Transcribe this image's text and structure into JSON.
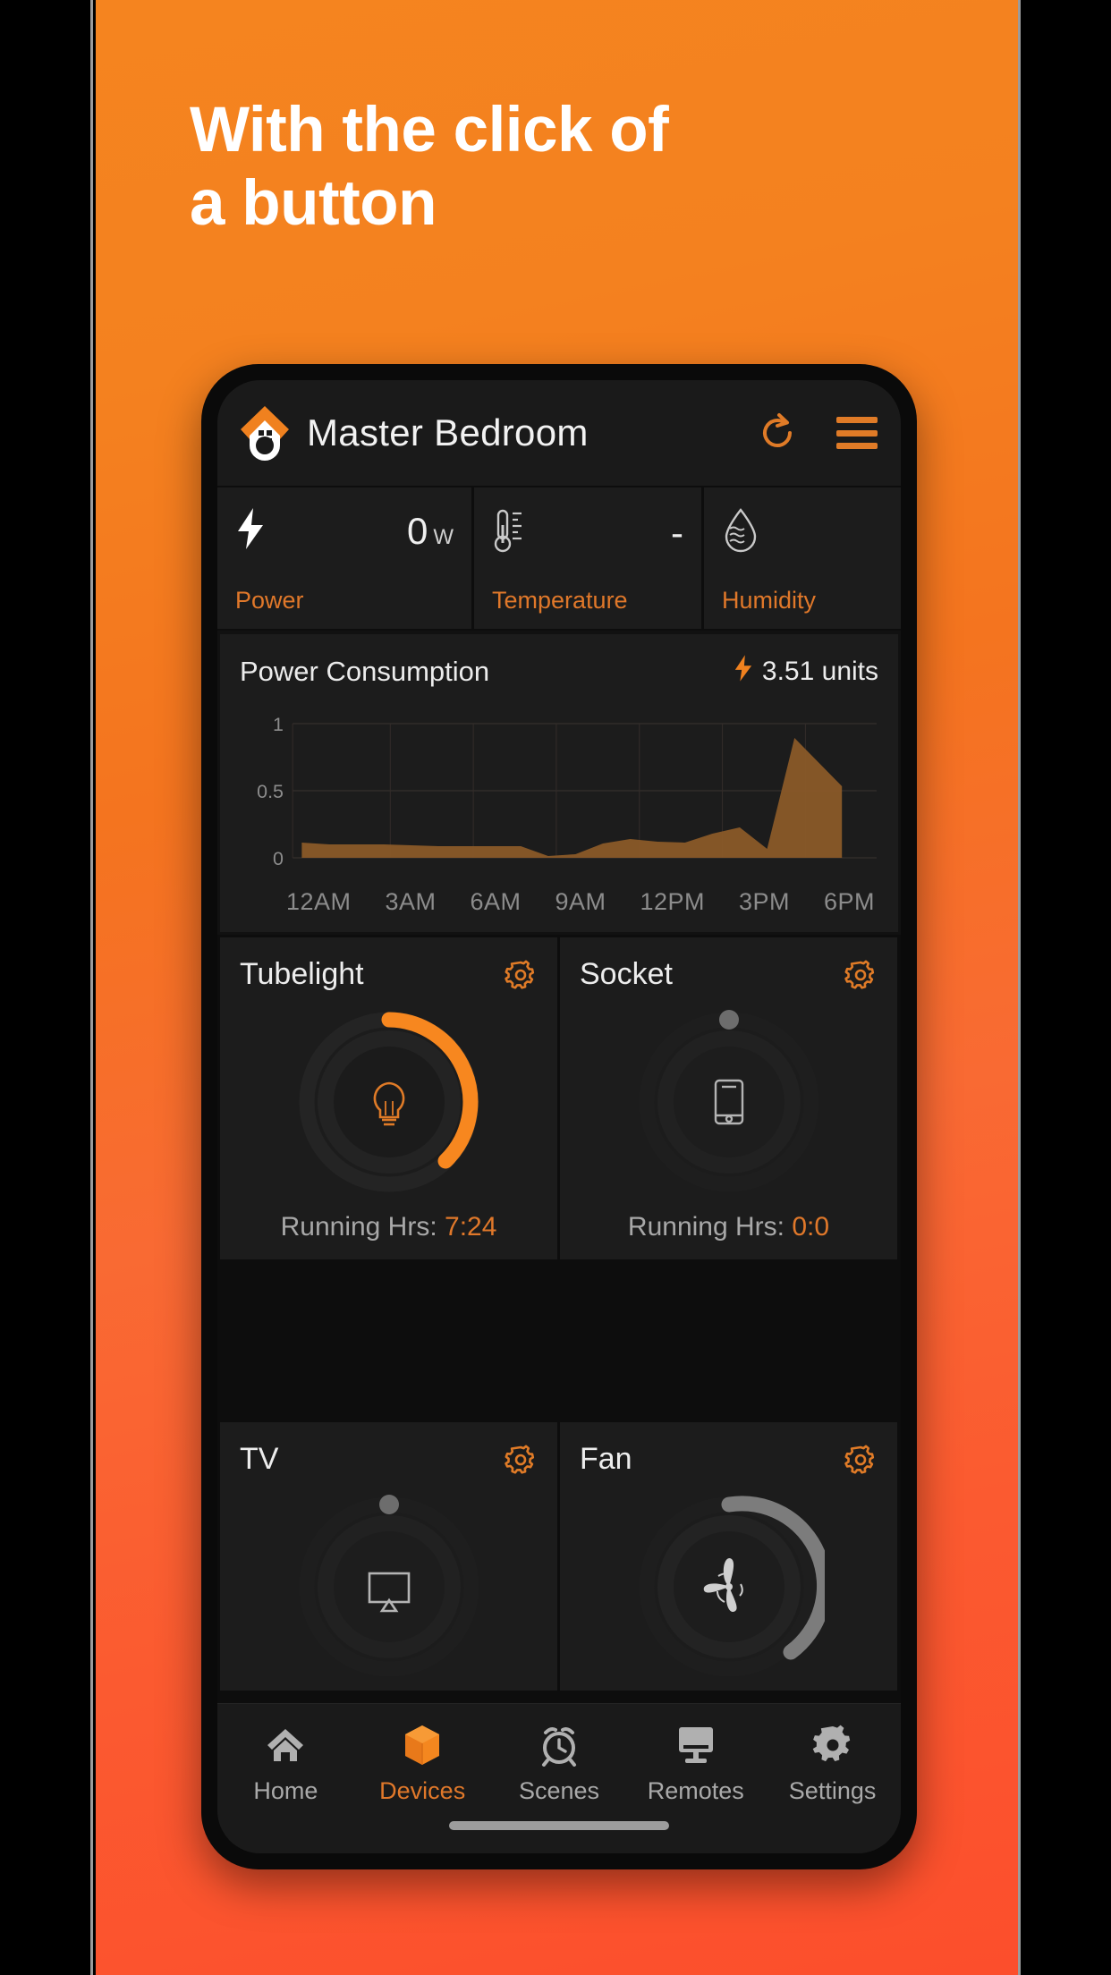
{
  "promo": {
    "headline_line1": "With the click of",
    "headline_line2": "a button",
    "gradient_top": "#F5841F",
    "gradient_bottom": "#FC4E2C",
    "accent": "#E0782A"
  },
  "app": {
    "header": {
      "title": "Master Bedroom",
      "refresh_icon": "refresh-icon",
      "menu_icon": "hamburger-menu-icon",
      "logo_icon": "home-brand-logo-icon"
    },
    "stats": [
      {
        "key": "power",
        "icon": "lightning-bolt-icon",
        "value": "0",
        "unit": "W",
        "label": "Power"
      },
      {
        "key": "temperature",
        "icon": "thermometer-icon",
        "value": "-",
        "unit": "",
        "label": "Temperature"
      },
      {
        "key": "humidity",
        "icon": "water-drop-icon",
        "value": "",
        "unit": "",
        "label": "Humidity"
      }
    ],
    "chart_card": {
      "title": "Power Consumption",
      "units_value": "3.51 units",
      "units_icon": "lightning-bolt-icon"
    },
    "devices": [
      {
        "name": "Tubelight",
        "icon": "lightbulb-icon",
        "state": "on",
        "value_pct": 42,
        "running_label": "Running Hrs: ",
        "running_value": "7:24",
        "gear": "gear-icon"
      },
      {
        "name": "Socket",
        "icon": "smartphone-icon",
        "state": "off",
        "value_pct": 0,
        "running_label": "Running Hrs: ",
        "running_value": "0:0",
        "gear": "gear-icon"
      },
      {
        "name": "TV",
        "icon": "tv-airplay-icon",
        "state": "off",
        "value_pct": 0,
        "running_label": "",
        "running_value": "",
        "gear": "gear-icon"
      },
      {
        "name": "Fan",
        "icon": "fan-blade-icon",
        "state": "dim",
        "value_pct": 45,
        "running_label": "",
        "running_value": "",
        "gear": "gear-icon"
      }
    ],
    "nav": [
      {
        "label": "Home",
        "icon": "home-icon",
        "active": false
      },
      {
        "label": "Devices",
        "icon": "cube-box-icon",
        "active": true
      },
      {
        "label": "Scenes",
        "icon": "alarm-clock-icon",
        "active": false
      },
      {
        "label": "Remotes",
        "icon": "monitor-icon",
        "active": false
      },
      {
        "label": "Settings",
        "icon": "gear-icon",
        "active": false
      }
    ]
  },
  "chart_data": {
    "type": "area",
    "title": "Power Consumption",
    "xlabel": "",
    "ylabel": "",
    "ylim": [
      0,
      1
    ],
    "yticks": [
      "0",
      "0.5",
      "1"
    ],
    "xticks": [
      "12AM",
      "3AM",
      "6AM",
      "9AM",
      "12PM",
      "3PM",
      "6PM"
    ],
    "grid": true,
    "total_units": 3.51,
    "x": [
      "12AM",
      "1AM",
      "2AM",
      "3AM",
      "4AM",
      "5AM",
      "6AM",
      "7AM",
      "8AM",
      "9AM",
      "10AM",
      "11AM",
      "12PM",
      "1PM",
      "2PM",
      "3PM",
      "4PM",
      "5PM",
      "6PM",
      "7PM"
    ],
    "values": [
      0.11,
      0.1,
      0.1,
      0.1,
      0.09,
      0.09,
      0.09,
      0.09,
      0.09,
      0.02,
      0.03,
      0.11,
      0.14,
      0.12,
      0.11,
      0.18,
      0.23,
      0.07,
      0.8,
      0.5
    ]
  }
}
